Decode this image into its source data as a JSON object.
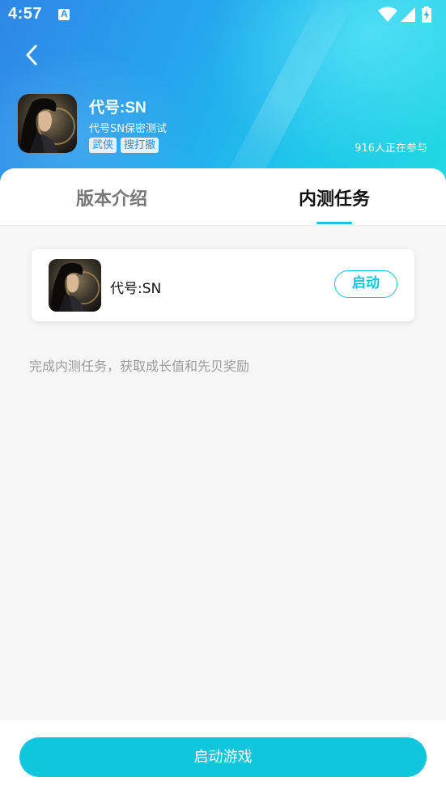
{
  "status_bar": {
    "time": "4:57",
    "notification_icon": "a-icon",
    "icons": [
      "wifi-icon",
      "signal-icon",
      "battery-charging-icon"
    ]
  },
  "header": {
    "back_icon": "chevron-left-icon",
    "app_name": "代号:SN",
    "subtitle": "代号SN保密测试",
    "tags": [
      "武侠",
      "搜打撤"
    ],
    "participants": "916人正在参与"
  },
  "tabs": [
    {
      "label": "版本介绍",
      "active": false
    },
    {
      "label": "内测任务",
      "active": true
    }
  ],
  "task_card": {
    "name": "代号:SN",
    "action_label": "启动"
  },
  "task_hint": "完成内测任务，获取成长值和先贝奖励",
  "bottom": {
    "start_label": "启动游戏"
  },
  "colors": {
    "accent": "#14c3d8",
    "header_gradient_start": "#2f86e6",
    "header_gradient_end": "#22d9e2",
    "tag_text": "#2a8fe8"
  }
}
